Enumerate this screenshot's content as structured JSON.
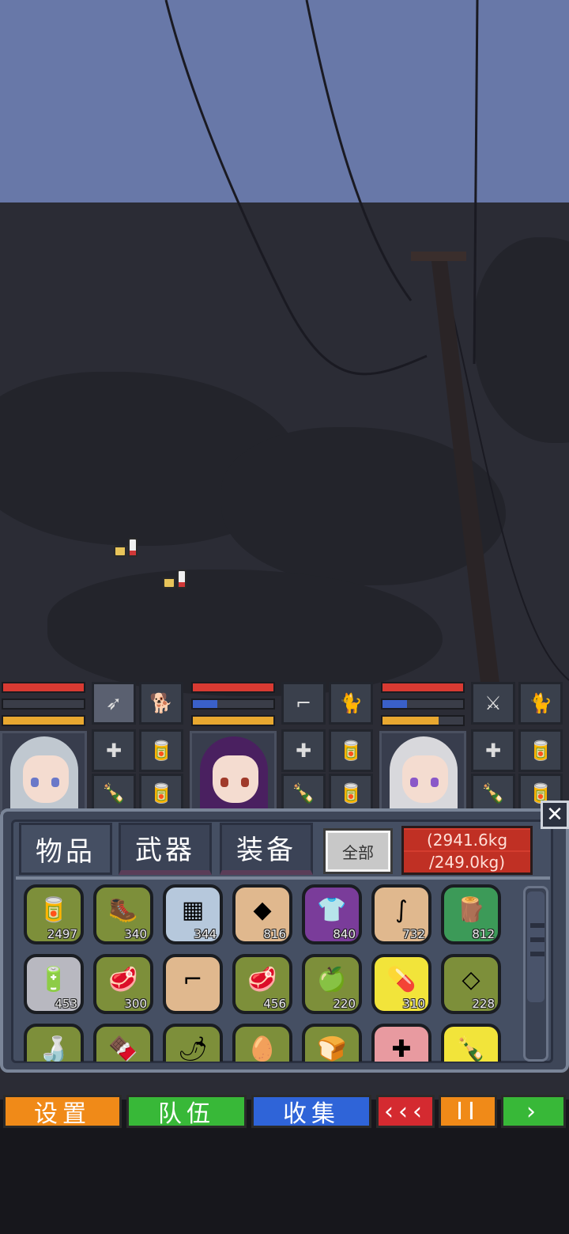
{
  "colors": {
    "sky": "#6878a8",
    "hp_bar": "#d83a32",
    "mp_bar": "#3a60c8",
    "stamina_bar": "#e8a830",
    "weight_bg": "#d43c2e",
    "menu_orange": "#f08a18",
    "menu_green": "#38b838",
    "menu_blue": "#2f64d8",
    "menu_red": "#d42a30"
  },
  "party": [
    {
      "name_icon": "silver-hair-girl",
      "hp": 1.0,
      "mp": 0.0,
      "stamina": 1.0,
      "weapon_icon": "bow-icon",
      "companion_icon": "dog-icon",
      "quick_items": [
        "medkit-icon",
        "food-ration-icon",
        "bottle-icon",
        "canned-food-icon"
      ]
    },
    {
      "name_icon": "purple-hair-girl",
      "hp": 1.0,
      "mp": 0.3,
      "stamina": 1.0,
      "weapon_icon": "gun-icon",
      "companion_icon": "cat-icon",
      "quick_items": [
        "medkit-icon",
        "food-ration-icon",
        "bottle-icon",
        "canned-food-icon"
      ]
    },
    {
      "name_icon": "white-hair-boy",
      "hp": 1.0,
      "mp": 0.3,
      "stamina": 0.7,
      "weapon_icon": "blade-icon",
      "companion_icon": "cat-icon",
      "quick_items": [
        "medkit-icon",
        "food-ration-icon",
        "bottle-icon",
        "canned-food-icon"
      ]
    }
  ],
  "inventory": {
    "tabs": [
      "物品",
      "武器",
      "装备"
    ],
    "filter_label": "全部",
    "weight_current": "(2941.6kg",
    "weight_max": "/249.0kg)",
    "close_label": "✕",
    "items": [
      {
        "icon": "food-ration-icon",
        "glyph": "🥫",
        "count": "2497",
        "bg": "olive"
      },
      {
        "icon": "boots-icon",
        "glyph": "🥾",
        "count": "340",
        "bg": "olive"
      },
      {
        "icon": "circuit-board-icon",
        "glyph": "▦",
        "count": "344",
        "bg": "lblue"
      },
      {
        "icon": "stone-icon",
        "glyph": "◆",
        "count": "816",
        "bg": "tan"
      },
      {
        "icon": "shirt-icon",
        "glyph": "👕",
        "count": "840",
        "bg": "purple"
      },
      {
        "icon": "rope-icon",
        "glyph": "∫",
        "count": "732",
        "bg": "tan"
      },
      {
        "icon": "wood-log-icon",
        "glyph": "🪵",
        "count": "812",
        "bg": "green"
      },
      {
        "icon": "battery-icon",
        "glyph": "🔋",
        "count": "453",
        "bg": "grey"
      },
      {
        "icon": "raw-meat-icon",
        "glyph": "🥩",
        "count": "300",
        "bg": "olive"
      },
      {
        "icon": "rifle-icon",
        "glyph": "⌐",
        "count": "",
        "bg": "tan"
      },
      {
        "icon": "steak-icon",
        "glyph": "🥩",
        "count": "456",
        "bg": "olive"
      },
      {
        "icon": "apple-icon",
        "glyph": "🍏",
        "count": "220",
        "bg": "olive"
      },
      {
        "icon": "medicine-icon",
        "glyph": "💊",
        "count": "310",
        "bg": "yellow"
      },
      {
        "icon": "cloth-icon",
        "glyph": "◇",
        "count": "228",
        "bg": "olive"
      },
      {
        "icon": "milk-bottle-icon",
        "glyph": "🍶",
        "count": "",
        "bg": "olive"
      },
      {
        "icon": "chocolate-icon",
        "glyph": "🍫",
        "count": "",
        "bg": "olive"
      },
      {
        "icon": "chili-pepper-icon",
        "glyph": "🌶",
        "count": "",
        "bg": "olive"
      },
      {
        "icon": "egg-icon",
        "glyph": "🥚",
        "count": "",
        "bg": "olive"
      },
      {
        "icon": "bread-icon",
        "glyph": "🍞",
        "count": "",
        "bg": "olive"
      },
      {
        "icon": "first-aid-icon",
        "glyph": "✚",
        "count": "",
        "bg": "pink"
      },
      {
        "icon": "liquor-bottle-icon",
        "glyph": "🍾",
        "count": "",
        "bg": "yellow"
      }
    ]
  },
  "bottom_menu": [
    {
      "label": "设置",
      "color": "#f08a18"
    },
    {
      "label": "队伍",
      "color": "#38b838"
    },
    {
      "label": "收集",
      "color": "#2f64d8"
    },
    {
      "label": "‹‹‹",
      "color": "#d42a30"
    },
    {
      "label": "II",
      "color": "#f08a18"
    },
    {
      "label": "›",
      "color": "#38b838"
    }
  ]
}
